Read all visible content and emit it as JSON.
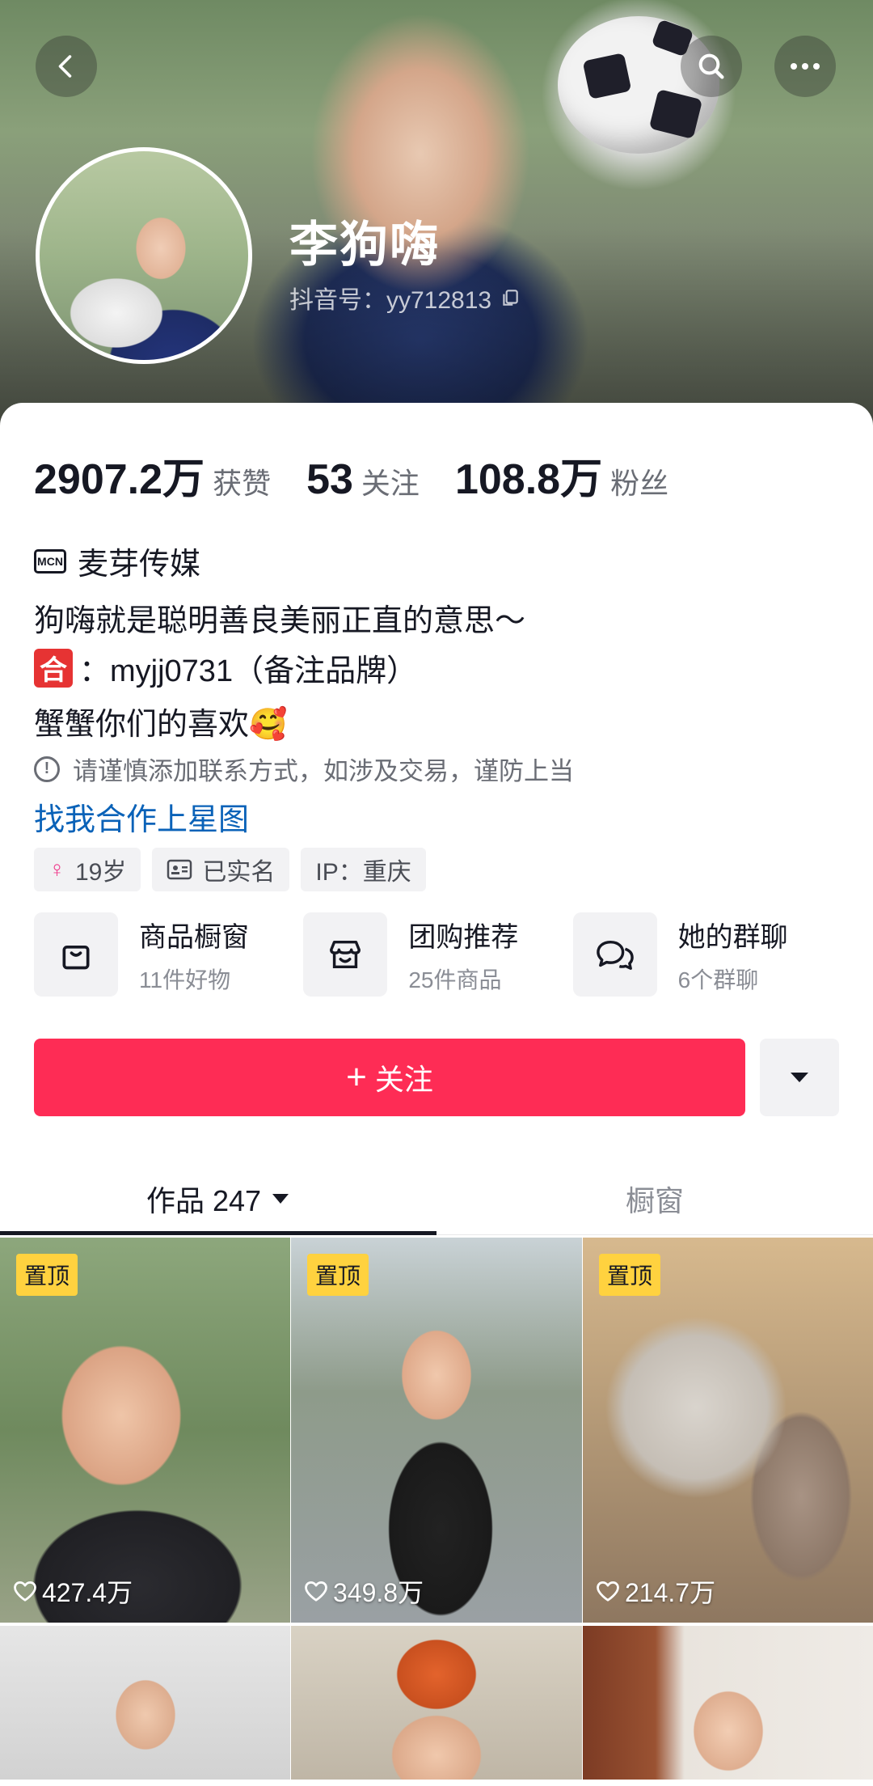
{
  "profile": {
    "name": "李狗嗨",
    "account_id": "抖音号：yy712813"
  },
  "stats": [
    {
      "num": "2907.2万",
      "label": "获赞"
    },
    {
      "num": "53",
      "label": "关注"
    },
    {
      "num": "108.8万",
      "label": "粉丝"
    }
  ],
  "bio": {
    "mcn_badge": "MCN",
    "mcn_name": "麦芽传媒",
    "line1": "狗嗨就是聪明善良美丽正直的意思～",
    "he_badge": "合",
    "line2": "：myjj0731（备注品牌）",
    "line3": "蟹蟹你们的喜欢🥰",
    "warning": "请谨慎添加联系方式，如涉及交易，谨防上当",
    "cta_link": "找我合作上星图"
  },
  "tags": [
    "19岁",
    "已实名",
    "IP：重庆"
  ],
  "services": [
    {
      "title": "商品橱窗",
      "sub": "11件好物",
      "icon": "shopping-bag-icon"
    },
    {
      "title": "团购推荐",
      "sub": "25件商品",
      "icon": "store-icon"
    },
    {
      "title": "她的群聊",
      "sub": "6个群聊",
      "icon": "chat-bubbles-icon"
    }
  ],
  "actions": {
    "follow_plus": "+",
    "follow_label": "关注"
  },
  "tabs": [
    {
      "label": "作品 247"
    },
    {
      "label": "橱窗"
    }
  ],
  "videos": [
    {
      "pinned": "置顶",
      "likes": "427.4万"
    },
    {
      "pinned": "置顶",
      "likes": "349.8万"
    },
    {
      "pinned": "置顶",
      "likes": "214.7万"
    }
  ],
  "colors": {
    "follow_button": "#fe2c55",
    "link": "#0a62b8",
    "pin_badge": "#ffd23f"
  }
}
